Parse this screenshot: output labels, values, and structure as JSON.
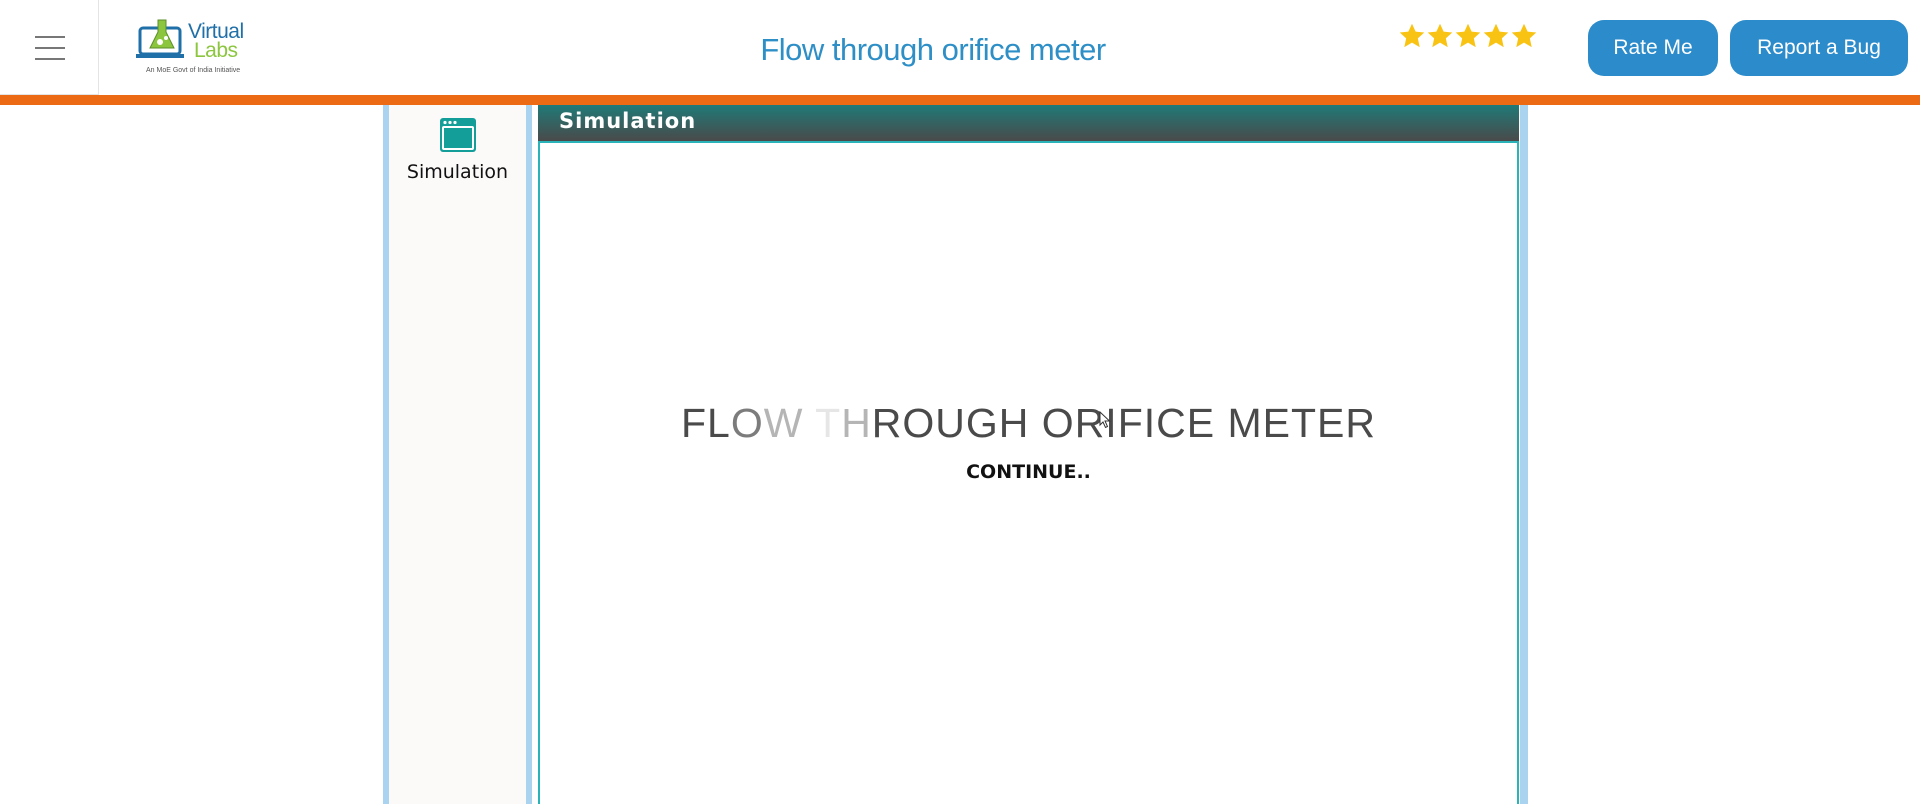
{
  "header": {
    "logo_line1": "Virtual",
    "logo_line2": "Labs",
    "logo_tagline": "An MoE Govt of India Initiative",
    "title": "Flow through orifice meter",
    "rating_stars": 5,
    "rate_button": "Rate Me",
    "bug_button": "Report a Bug",
    "accent_color": "#2e8fc7",
    "orange_bar_color": "#ec6a13"
  },
  "sidebar": {
    "items": [
      {
        "label": "Simulation",
        "icon": "browser-window-icon"
      }
    ]
  },
  "panel": {
    "header": "Simulation",
    "title_part1": "FL",
    "title_part2": "O",
    "title_part3": "W ",
    "title_part4": "T",
    "title_part5": "H",
    "title_part6": "ROUGH ORIFICE METER",
    "continue_label": "CONTINUE.."
  }
}
